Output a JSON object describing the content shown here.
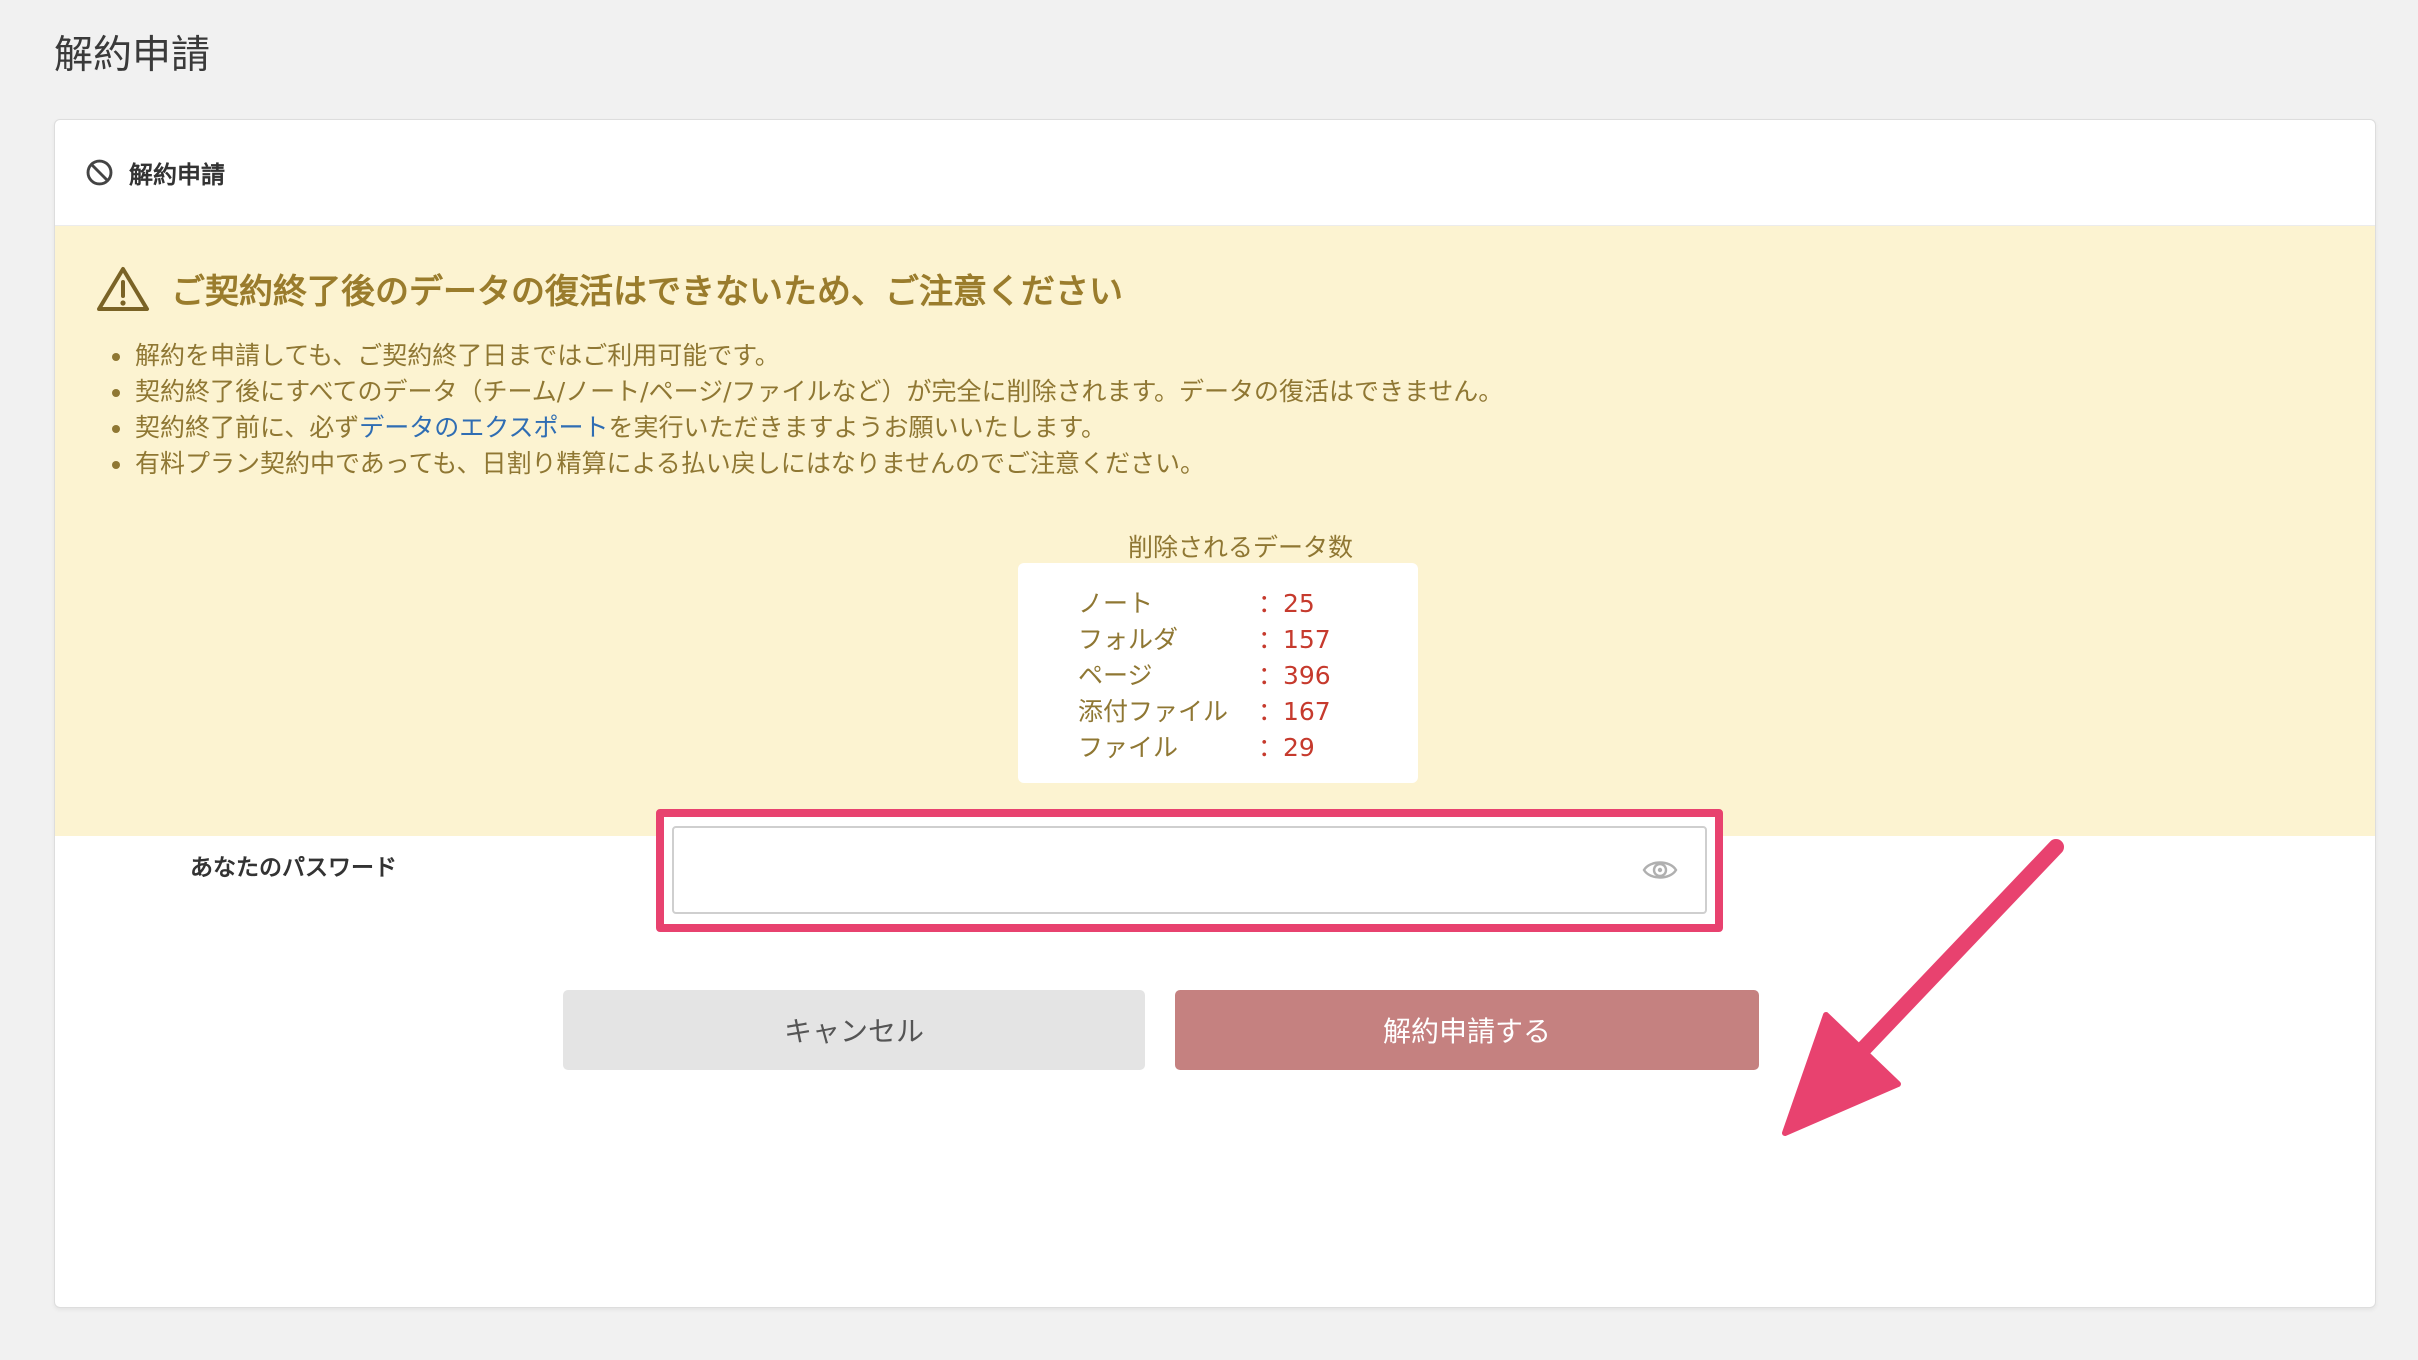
{
  "page": {
    "title": "解約申請"
  },
  "card": {
    "header_title": "解約申請"
  },
  "warning": {
    "title": "ご契約終了後のデータの復活はできないため、ご注意ください",
    "notes": [
      "解約を申請しても、ご契約終了日まではご利用可能です。",
      "契約終了後にすべてのデータ（チーム/ノート/ページ/ファイルなど）が完全に削除されます。データの復活はできません。",
      "有料プラン契約中であっても、日割り精算による払い戻しにはなりませんのでご注意ください。"
    ],
    "export_note": {
      "before": "契約終了前に、必ず",
      "link": "データのエクスポート",
      "after": "を実行いただきますようお願いいたします。"
    },
    "stats_title": "削除されるデータ数",
    "stats": [
      {
        "label": "ノート",
        "value": "：25"
      },
      {
        "label": "フォルダ",
        "value": "：157"
      },
      {
        "label": "ページ",
        "value": "：396"
      },
      {
        "label": "添付ファイル",
        "value": "：167"
      },
      {
        "label": "ファイル",
        "value": "：29"
      }
    ]
  },
  "form": {
    "password_label": "あなたのパスワード",
    "password_value": "",
    "cancel_label": "キャンセル",
    "submit_label": "解約申請する"
  },
  "colors": {
    "warning_bg": "#fcf3d1",
    "warning_text": "#8f7733",
    "stat_value": "#c63a2d",
    "link": "#2f6db3",
    "submit_bg": "#c58180",
    "annotation": "#e8426f"
  },
  "icons": {
    "header": "ban-icon",
    "warning": "warning-triangle-icon",
    "password_toggle": "eye-icon"
  }
}
